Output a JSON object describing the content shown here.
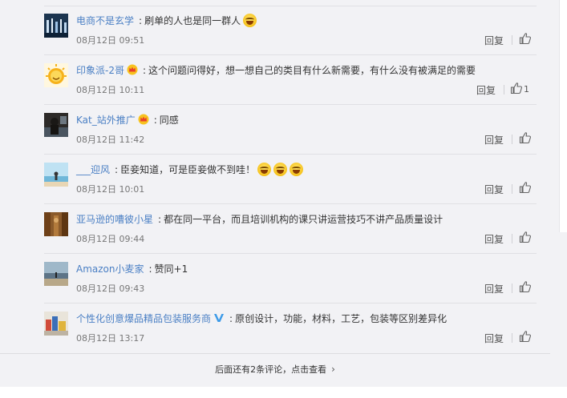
{
  "comments": [
    {
      "name": "电商不是玄学",
      "crown": false,
      "vip": false,
      "text": "刷单的人也是同一群人",
      "emoji": true,
      "emoji_count": 1,
      "time": "08月12日 09:51",
      "reply": "回复",
      "likes": ""
    },
    {
      "name": "印象派-2哥",
      "crown": true,
      "vip": false,
      "text": "这个问题问得好，想一想自己的类目有什么新需要，有什么没有被满足的需要",
      "emoji": false,
      "emoji_count": 0,
      "time": "08月12日 10:11",
      "reply": "回复",
      "likes": "1"
    },
    {
      "name": "Kat_站外推广",
      "crown": true,
      "vip": false,
      "text": "同感",
      "emoji": false,
      "emoji_count": 0,
      "time": "08月12日 11:42",
      "reply": "回复",
      "likes": ""
    },
    {
      "name": "___迎风",
      "crown": false,
      "vip": false,
      "text": "臣妾知道，可是臣妾做不到哇！",
      "emoji": true,
      "emoji_count": 3,
      "time": "08月12日 10:01",
      "reply": "回复",
      "likes": ""
    },
    {
      "name": "亚马逊的嘈彼小星",
      "crown": false,
      "vip": false,
      "text": "都在同一平台，而且培训机构的课只讲运营技巧不讲产品质量设计",
      "emoji": false,
      "emoji_count": 0,
      "time": "08月12日 09:44",
      "reply": "回复",
      "likes": ""
    },
    {
      "name": "Amazon小麦家",
      "crown": false,
      "vip": false,
      "text": "赞同+1",
      "emoji": false,
      "emoji_count": 0,
      "time": "08月12日 09:43",
      "reply": "回复",
      "likes": ""
    },
    {
      "name": "个性化创意爆品精品包装服务商",
      "crown": false,
      "vip": true,
      "text": "原创设计，功能，材料，工艺，包装等区别差异化",
      "emoji": false,
      "emoji_count": 0,
      "time": "08月12日 13:17",
      "reply": "回复",
      "likes": ""
    }
  ],
  "more_comments": "后面还有2条评论，点击查看",
  "icons": {
    "like": "thumbs-up-icon",
    "crown": "crown-badge-icon",
    "vip": "verified-v-icon",
    "more": "chevron-right-icon",
    "emoji": "laughing-emoji-icon"
  },
  "colors": {
    "username": "#4a7fc4",
    "background": "#f2f2f5",
    "vip": "#3d9be8"
  }
}
